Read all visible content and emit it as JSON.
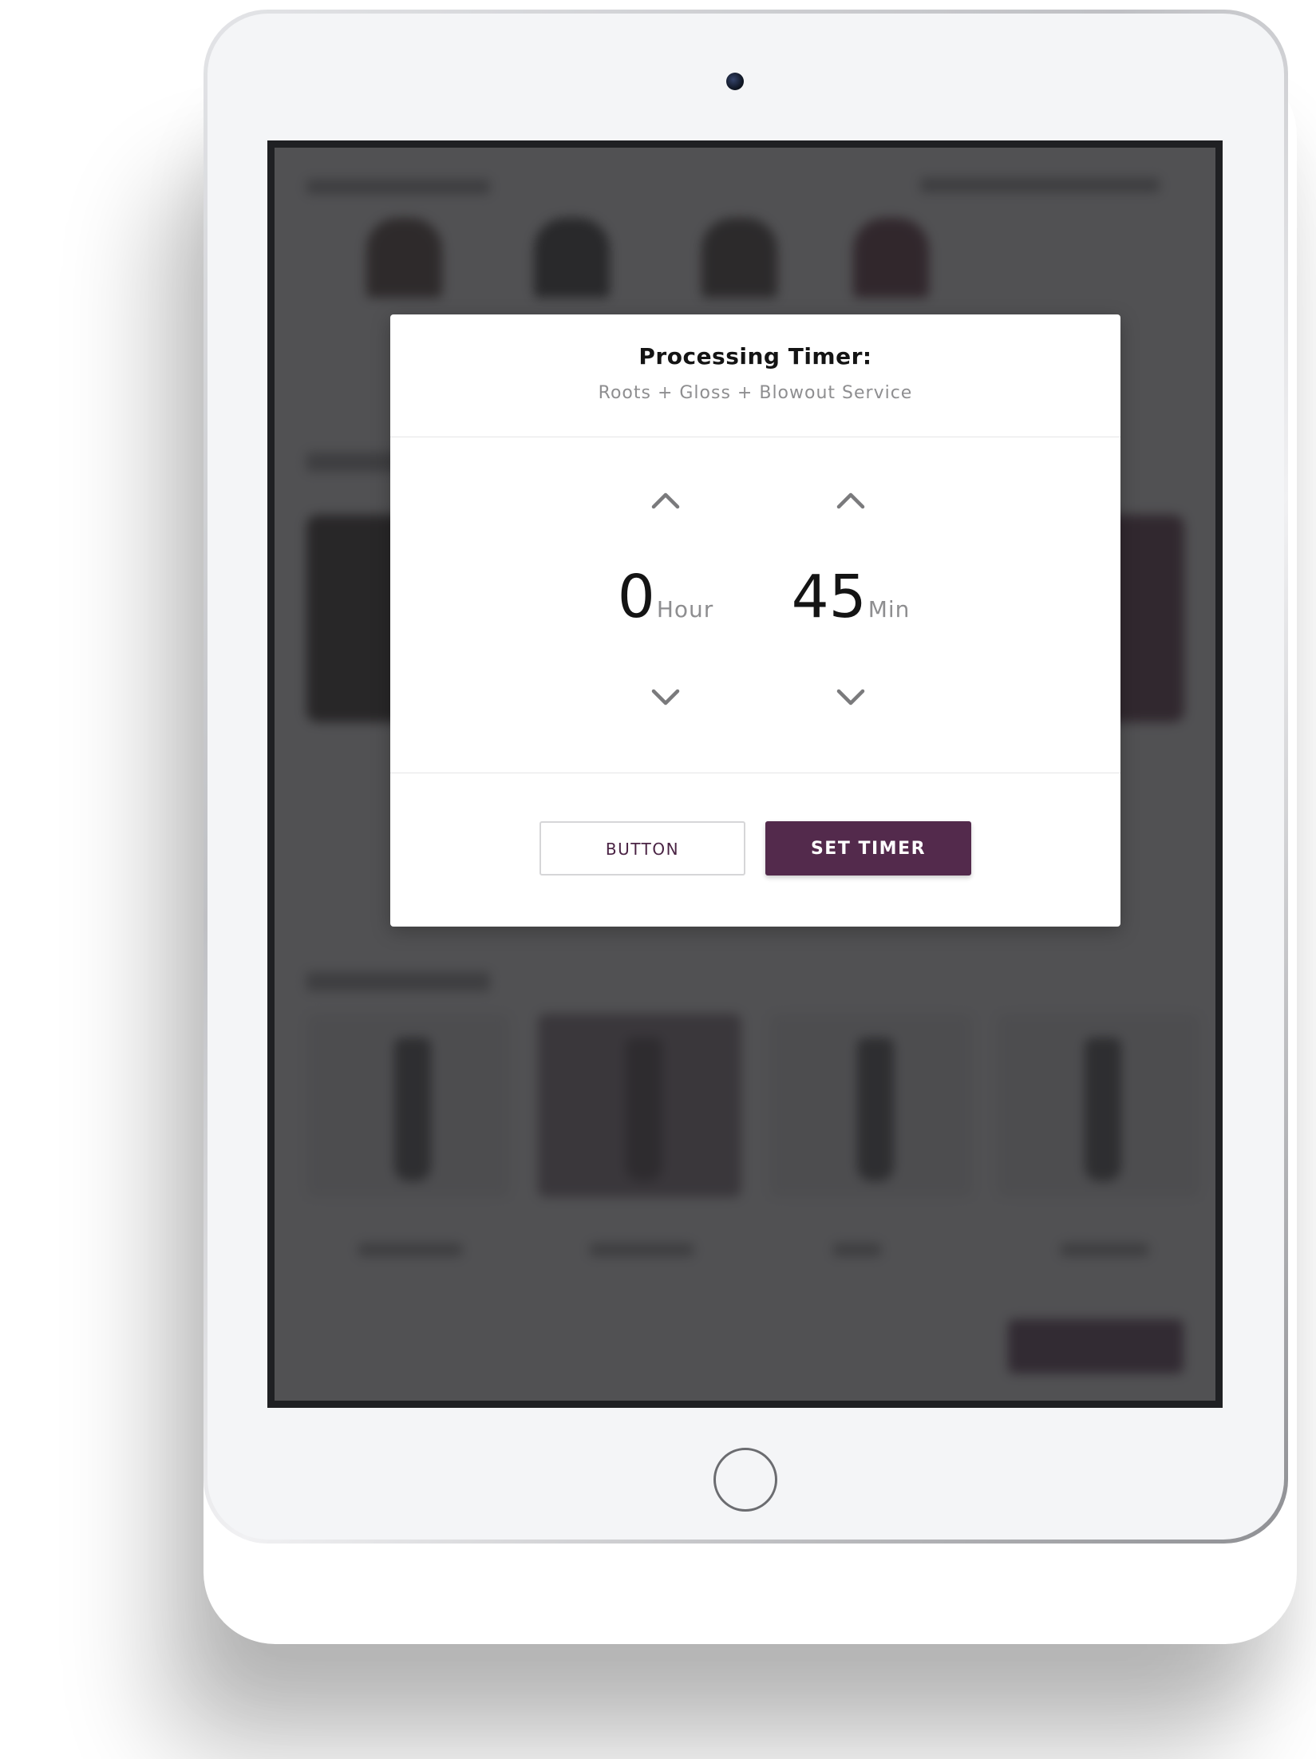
{
  "colors": {
    "brand_plum": "#532a4c",
    "overlay": "#2c2c2e",
    "text_primary": "#141414",
    "text_secondary": "#8e8e90"
  },
  "timer_dialog": {
    "title": "Processing Timer:",
    "service": "Roots + Gloss + Blowout Service",
    "hours": {
      "value": "0",
      "unit": "Hour",
      "increment_icon": "chevron-up-icon",
      "decrement_icon": "chevron-down-icon"
    },
    "minutes": {
      "value": "45",
      "unit": "Min",
      "increment_icon": "chevron-up-icon",
      "decrement_icon": "chevron-down-icon"
    },
    "secondary_button_label": "BUTTON",
    "primary_button_label": "SET TIMER"
  }
}
